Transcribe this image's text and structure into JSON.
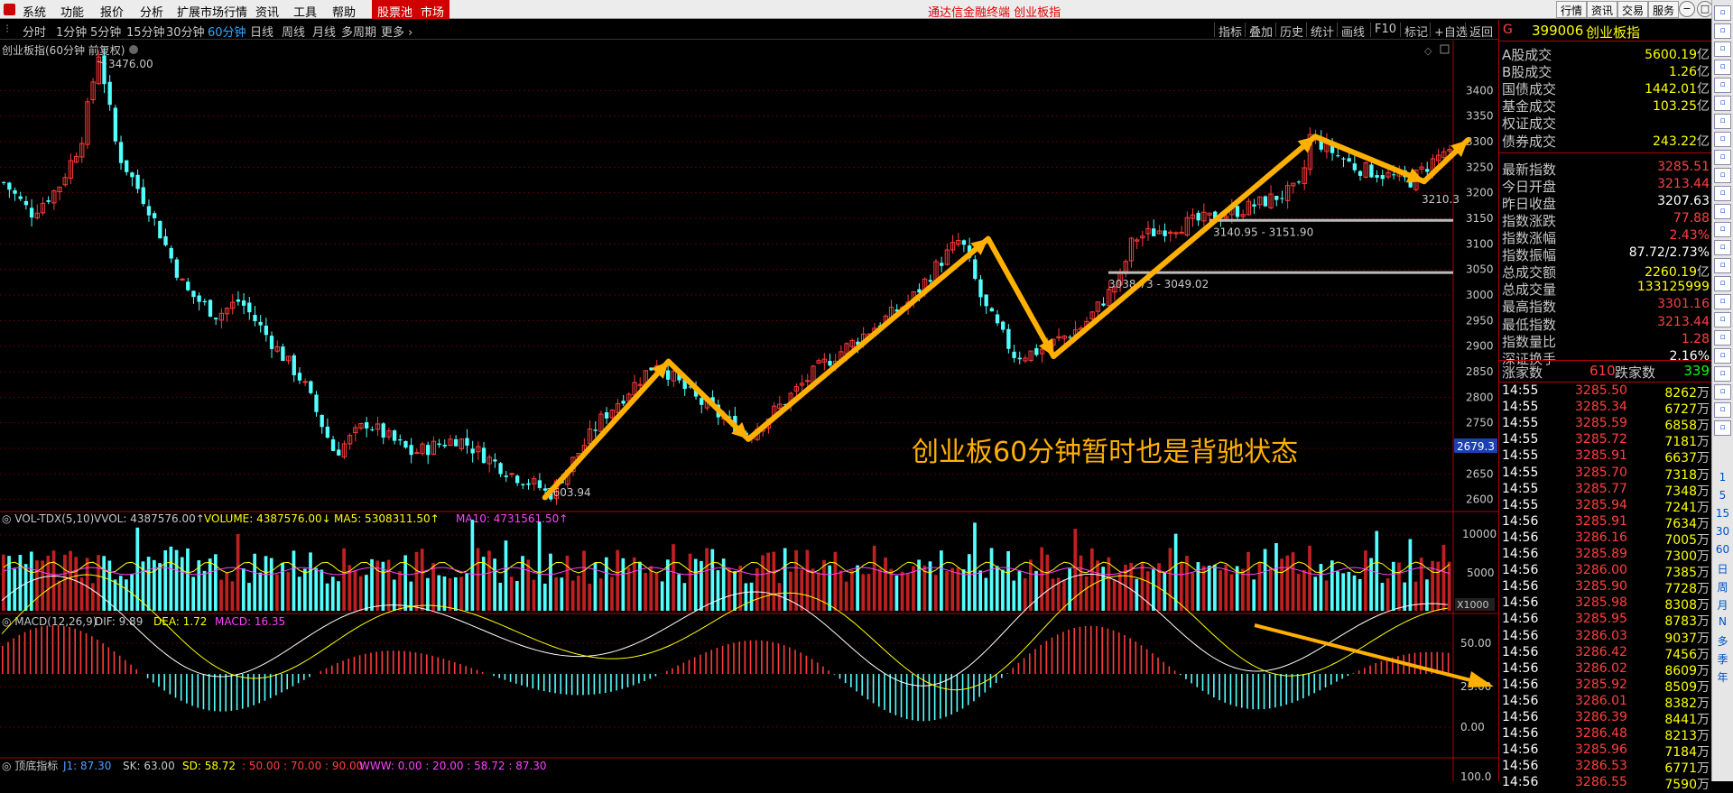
{
  "menu": {
    "items": [
      "系统",
      "功能",
      "报价",
      "分析",
      "扩展市场行情",
      "资讯",
      "工具",
      "帮助"
    ],
    "tab_stock_pool": "股票池",
    "tab_market": "市场",
    "title": "通达信金融终端  创业板指",
    "right_buttons": [
      "行情",
      "资讯",
      "交易",
      "服务"
    ],
    "window_buttons": [
      "−",
      "□",
      "✕"
    ]
  },
  "toolbar": {
    "periods": [
      "分时",
      "1分钟",
      "5分钟",
      "15分钟",
      "30分钟",
      "60分钟",
      "日线",
      "周线",
      "月线",
      "多周期",
      "更多"
    ],
    "active": "60分钟",
    "right_items": [
      "指标",
      "叠加",
      "历史",
      "统计",
      "画线",
      "F10",
      "标记",
      "+自选",
      "返回"
    ]
  },
  "chart": {
    "title": "创业板指(60分钟 前复权)",
    "high_label": "3476.00",
    "low_label": "2603.94",
    "last_label": "3210.3",
    "current_price": "2679.3",
    "zone1": "3140.95 - 3151.90",
    "zone2": "3038.73 - 3049.02",
    "annotation": "创业板60分钟暂时也是背驰状态",
    "y_ticks": [
      "3400",
      "3350",
      "3300",
      "3250",
      "3200",
      "3150",
      "3100",
      "3050",
      "3000",
      "2950",
      "2900",
      "2850",
      "2800",
      "2750",
      "2700",
      "2650",
      "2600"
    ],
    "vol": {
      "name": "VOL-TDX(5,10)",
      "vvol": "VVOL: 4387576.00",
      "volume": "VOLUME: 4387576.00",
      "ma5": "MA5: 5308311.50",
      "ma10": "MA10: 4731561.50",
      "ticks": [
        "10000",
        "5000"
      ],
      "unit": "X1000"
    },
    "macd": {
      "name": "MACD(12,26,9)",
      "dif": "DIF: 9.89",
      "dea": "DEA: 1.72",
      "macd": "MACD: 16.35",
      "ticks": [
        "50.00",
        "25.00",
        "0.00"
      ]
    },
    "kdj": {
      "name": "顶底指标",
      "j1": "J1: 87.30",
      "sk": "SK: 63.00",
      "sd": "SD: 58.72",
      "rest": ": 50.00  : 70.00  : 90.00",
      "www": "WWW: 0.00  : 20.00  : 58.72  : 87.30",
      "tick": "100.0"
    }
  },
  "chart_data": {
    "type": "candlestick",
    "title": "创业板指(60分钟 前复权)",
    "ylim": [
      2580,
      3480
    ],
    "zigzag_points": [
      [
        0.375,
        2603.94
      ],
      [
        0.46,
        2870
      ],
      [
        0.515,
        2718
      ],
      [
        0.68,
        3110
      ],
      [
        0.725,
        2880
      ],
      [
        0.905,
        3310
      ],
      [
        0.98,
        3222
      ],
      [
        1.01,
        3303
      ]
    ],
    "high": 3476.0,
    "low": 2603.94,
    "last": 3210.3,
    "zones": [
      [
        3140.95,
        3151.9
      ],
      [
        3038.73,
        3049.02
      ]
    ]
  },
  "quote": {
    "code_prefix": "G",
    "code": "399006",
    "name": "创业板指",
    "rows": [
      {
        "label": "A股成交",
        "value": "5600.19",
        "unit": "亿",
        "color": "#ffff00"
      },
      {
        "label": "B股成交",
        "value": "1.26",
        "unit": "亿",
        "color": "#ffff00"
      },
      {
        "label": "国债成交",
        "value": "1442.01",
        "unit": "亿",
        "color": "#ffff00"
      },
      {
        "label": "基金成交",
        "value": "103.25",
        "unit": "亿",
        "color": "#ffff00"
      },
      {
        "label": "权证成交",
        "value": "",
        "unit": "",
        "color": "#ffff00"
      },
      {
        "label": "债券成交",
        "value": "243.22",
        "unit": "亿",
        "color": "#ffff00"
      },
      {
        "label": "最新指数",
        "value": "3285.51",
        "unit": "",
        "color": "#ff4040"
      },
      {
        "label": "今日开盘",
        "value": "3213.44",
        "unit": "",
        "color": "#ff4040"
      },
      {
        "label": "昨日收盘",
        "value": "3207.63",
        "unit": "",
        "color": "#ffffff"
      },
      {
        "label": "指数涨跌",
        "value": "77.88",
        "unit": "",
        "color": "#ff4040"
      },
      {
        "label": "指数涨幅",
        "value": "2.43%",
        "unit": "",
        "color": "#ff4040"
      },
      {
        "label": "指数振幅",
        "value": "87.72/2.73%",
        "unit": "",
        "color": "#ffffff"
      },
      {
        "label": "总成交额",
        "value": "2260.19",
        "unit": "亿",
        "color": "#ffff00"
      },
      {
        "label": "总成交量",
        "value": "133125999",
        "unit": "",
        "color": "#ffff00"
      },
      {
        "label": "最高指数",
        "value": "3301.16",
        "unit": "",
        "color": "#ff4040"
      },
      {
        "label": "最低指数",
        "value": "3213.44",
        "unit": "",
        "color": "#ff4040"
      },
      {
        "label": "指数量比",
        "value": "1.28",
        "unit": "",
        "color": "#ff4040"
      },
      {
        "label": "深证换手",
        "value": "2.16%",
        "unit": "",
        "color": "#ffffff"
      }
    ],
    "up_label": "涨家数",
    "up": "610",
    "down_label": "跌家数",
    "down": "339"
  },
  "ticks": [
    [
      "14:55",
      "3285.50",
      "8262",
      "万"
    ],
    [
      "14:55",
      "3285.34",
      "6727",
      "万"
    ],
    [
      "14:55",
      "3285.59",
      "6858",
      "万"
    ],
    [
      "14:55",
      "3285.72",
      "7181",
      "万"
    ],
    [
      "14:55",
      "3285.91",
      "6637",
      "万"
    ],
    [
      "14:55",
      "3285.70",
      "7318",
      "万"
    ],
    [
      "14:55",
      "3285.77",
      "7348",
      "万"
    ],
    [
      "14:55",
      "3285.94",
      "7241",
      "万"
    ],
    [
      "14:56",
      "3285.91",
      "7634",
      "万"
    ],
    [
      "14:56",
      "3286.16",
      "7005",
      "万"
    ],
    [
      "14:56",
      "3285.89",
      "7300",
      "万"
    ],
    [
      "14:56",
      "3286.00",
      "7385",
      "万"
    ],
    [
      "14:56",
      "3285.90",
      "7728",
      "万"
    ],
    [
      "14:56",
      "3285.98",
      "8308",
      "万"
    ],
    [
      "14:56",
      "3285.95",
      "8783",
      "万"
    ],
    [
      "14:56",
      "3286.03",
      "9037",
      "万"
    ],
    [
      "14:56",
      "3286.42",
      "7456",
      "万"
    ],
    [
      "14:56",
      "3286.02",
      "8609",
      "万"
    ],
    [
      "14:56",
      "3285.92",
      "8509",
      "万"
    ],
    [
      "14:56",
      "3286.01",
      "8382",
      "万"
    ],
    [
      "14:56",
      "3286.39",
      "8441",
      "万"
    ],
    [
      "14:56",
      "3286.48",
      "8213",
      "万"
    ],
    [
      "14:56",
      "3285.96",
      "7184",
      "万"
    ],
    [
      "14:56",
      "3286.53",
      "6771",
      "万"
    ],
    [
      "14:56",
      "3286.55",
      "7590",
      "万"
    ]
  ],
  "sidebar": [
    "1",
    "5",
    "15",
    "30",
    "60",
    "日",
    "周",
    "月",
    "N",
    "多",
    "季",
    "年"
  ]
}
